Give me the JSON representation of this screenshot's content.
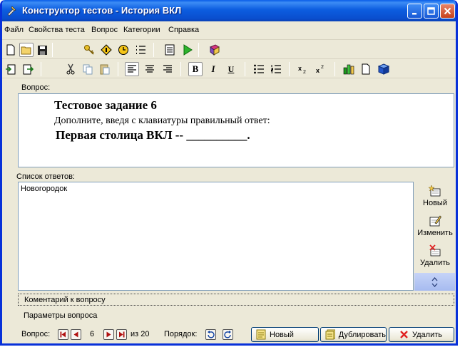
{
  "window": {
    "title": "Конструктор тестов - История ВКЛ"
  },
  "menu": [
    "Файл",
    "Свойства теста",
    "Вопрос",
    "Категории",
    "Справка"
  ],
  "question": {
    "section_label": "Вопрос:",
    "title": "Тестовое задание 6",
    "instruction": "Дополните, введя с клавиатуры правильный ответ:",
    "text": "Первая столица ВКЛ -- __________."
  },
  "answers": {
    "section_label": "Список ответов:",
    "items": [
      "Новогородок"
    ],
    "new_label": "Новый",
    "edit_label": "Изменить",
    "delete_label": "Удалить"
  },
  "panels": {
    "comment": "Коментарий к вопросу",
    "params": "Параметры вопроса"
  },
  "status": {
    "question_label": "Вопрос:",
    "current": "6",
    "of_label": "из 20",
    "order_label": "Порядок:",
    "new_button": "Новый",
    "duplicate_button": "Дублировать",
    "delete_button": "Удалить"
  },
  "toolbar2": {
    "bold": "B",
    "italic": "I",
    "underline": "U"
  }
}
